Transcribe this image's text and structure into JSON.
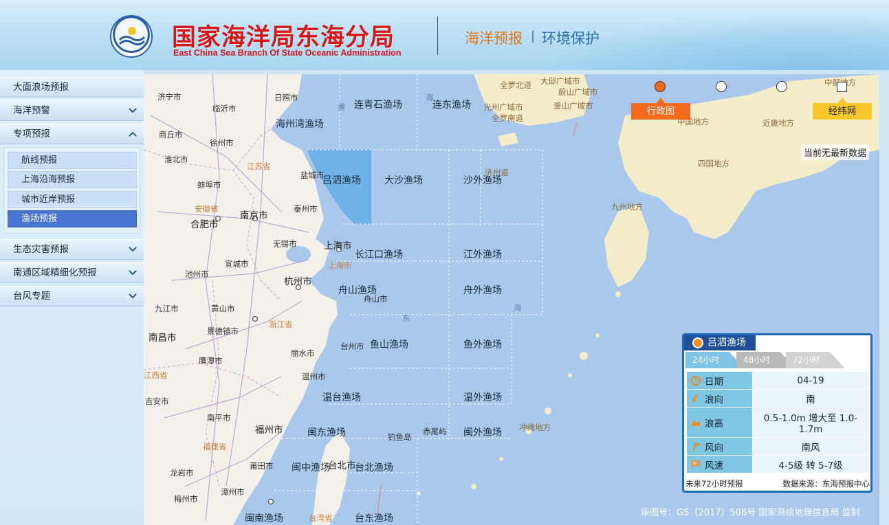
{
  "header": {
    "title_cn": "国家海洋局东海分局",
    "title_en": "East China Sea Branch Of State Oceanic Administration",
    "nav_ocean": "海洋预报",
    "nav_sep": "|",
    "nav_env": "环境保护",
    "colors": {
      "title": "#d5171a",
      "nav_active": "#e2771f",
      "nav": "#2a6cae"
    }
  },
  "sidebar": {
    "items": [
      {
        "label": "大面浪场预报"
      },
      {
        "label": "海洋预警"
      },
      {
        "label": "专项预报"
      },
      {
        "label": "生态灾害预报"
      },
      {
        "label": "南通区域精细化预报"
      },
      {
        "label": "台风专题"
      }
    ],
    "subitems": [
      {
        "label": "航线预报"
      },
      {
        "label": "上海沿海预报"
      },
      {
        "label": "城市近岸预报"
      },
      {
        "label": "渔场预报",
        "active": true
      }
    ],
    "active_color": "#4a75d0"
  },
  "map": {
    "fishing_grounds": [
      "连青石渔场",
      "连东渔场",
      "海州湾渔场",
      "吕泗渔场",
      "大沙渔场",
      "沙外渔场",
      "长江口渔场",
      "江外渔场",
      "舟山渔场",
      "舟外渔场",
      "鱼山渔场",
      "鱼外渔场",
      "温台渔场",
      "温外渔场",
      "闽东渔场",
      "闽外渔场",
      "闽中渔场",
      "台北渔场",
      "闽南渔场",
      "台东渔场"
    ],
    "cities": [
      "济宁市",
      "临沂市",
      "日照市",
      "商丘市",
      "徐州市",
      "淮北市",
      "蚌埠市",
      "盐城市",
      "泰州市",
      "南京市",
      "合肥市",
      "无锡市",
      "上海市",
      "宣城市",
      "杭州市",
      "池州市",
      "九江市",
      "黄山市",
      "舟山市",
      "南昌市",
      "景德镇市",
      "台州市",
      "丽水市",
      "鹰潭市",
      "温州市",
      "吉安市",
      "南平市",
      "福州市",
      "赤尾屿",
      "钓鱼岛",
      "龙岩市",
      "莆田市",
      "台北市",
      "梅州市",
      "漳州市"
    ],
    "provinces": [
      "江苏省",
      "安徽省",
      "浙江省",
      "江西省",
      "福建省",
      "上海市",
      "台湾省"
    ],
    "seas": [
      "海",
      "黄",
      "东",
      "海"
    ],
    "japan_korea": [
      "全罗北道",
      "大邱广域市",
      "蔚山广域市",
      "光州广域市",
      "釜山广域市",
      "全罗南道",
      "济州道",
      "中国地方",
      "近畿地方",
      "四国地方",
      "九州地方",
      "冲绳地方",
      "中部地方"
    ],
    "tag_admin": "行政图",
    "tag_grid": "经纬网",
    "no_data": "当前无最新数据",
    "review_no": "审图号：GS（2017）508号 国家测绘地理信息局 监制",
    "colors": {
      "sea": "#a9c8ec",
      "land": "#f4f1ea",
      "highlight": "#6fb3ea",
      "tag_admin": "#f26a1c",
      "tag_grid": "#f7c72b"
    }
  },
  "panel": {
    "title": "吕泗渔场",
    "tabs": [
      "24小时",
      "48小时",
      "72小时"
    ],
    "rows": [
      {
        "icon": "clock-icon",
        "key": "日期",
        "value": "04-19"
      },
      {
        "icon": "wave-direction-icon",
        "key": "浪向",
        "value": "南"
      },
      {
        "icon": "wave-height-icon",
        "key": "浪高",
        "value": "0.5-1.0m 增大至 1.0-1.7m"
      },
      {
        "icon": "wind-direction-icon",
        "key": "风向",
        "value": "南风"
      },
      {
        "icon": "wind-speed-icon",
        "key": "风速",
        "value": "4-5级 转 5-7级"
      }
    ],
    "footer_left": "未来72小时预报",
    "footer_right": "数据来源：东海预报中心"
  }
}
